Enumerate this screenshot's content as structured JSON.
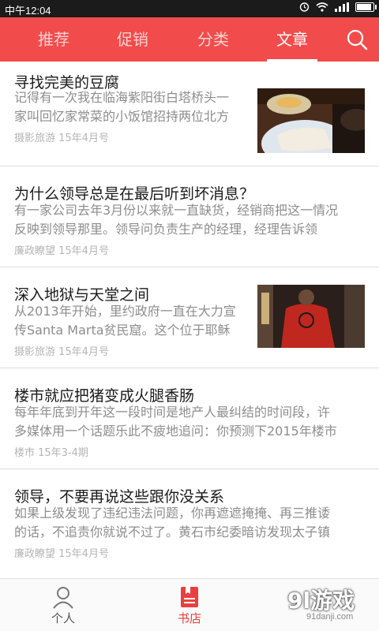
{
  "status_bar": {
    "time": "中午12:04"
  },
  "tabs": [
    {
      "label": "推荐",
      "active": false
    },
    {
      "label": "促销",
      "active": false
    },
    {
      "label": "分类",
      "active": false
    },
    {
      "label": "文章",
      "active": true
    }
  ],
  "articles": [
    {
      "title": "寻找完美的豆腐",
      "summary_line1": "记得有一次我在临海紫阳街白塔桥头一",
      "summary_line2": "家叫回忆家常菜的小饭馆招持两位北方",
      "meta": "摄影旅游 15年4月号",
      "has_image": true,
      "image": "tofu-dish"
    },
    {
      "title": "为什么领导总是在最后听到坏消息？",
      "summary_line1": "有一家公司去年3月份以来就一直缺货，经销商把这一情况",
      "summary_line2": "反映到领导那里。领导问负责生产的经理，经理告诉领",
      "meta": "廉政瞭望 15年4月号",
      "has_image": false
    },
    {
      "title": "深入地狱与天堂之间",
      "summary_line1": "从2013年开始，里约政府一直在大力宣",
      "summary_line2": "传Santa Marta贫民窟。这个位于耶稣",
      "meta": "摄影旅游 15年4月号",
      "has_image": true,
      "image": "person-red-shirt"
    },
    {
      "title": "楼市就应把猪变成火腿香肠",
      "summary_line1": "每年年底到开年这一段时间是地产人最纠结的时间段，许",
      "summary_line2": "多媒体用一个话题乐此不疲地追问：你预测下2015年楼市",
      "meta": "楼市 15年3-4期",
      "has_image": false
    },
    {
      "title": "领导，不要再说这些跟你没关系",
      "summary_line1": "如果上级发现了违纪违法问题，你再遮遮掩掩、再三推诿",
      "summary_line2": "的话，不追责你就说不过了。黄石市纪委暗访发现太子镇",
      "meta": "廉政瞭望 15年4月号",
      "has_image": false
    }
  ],
  "bottom_nav": [
    {
      "label": "个人",
      "icon": "person-icon",
      "active": false
    },
    {
      "label": "书店",
      "icon": "bookstore-icon",
      "active": true
    }
  ],
  "watermark": {
    "text": "9l游戏",
    "site": "91danji.com"
  },
  "colors": {
    "accent": "#f24b4b",
    "active_nav": "#e84040"
  }
}
